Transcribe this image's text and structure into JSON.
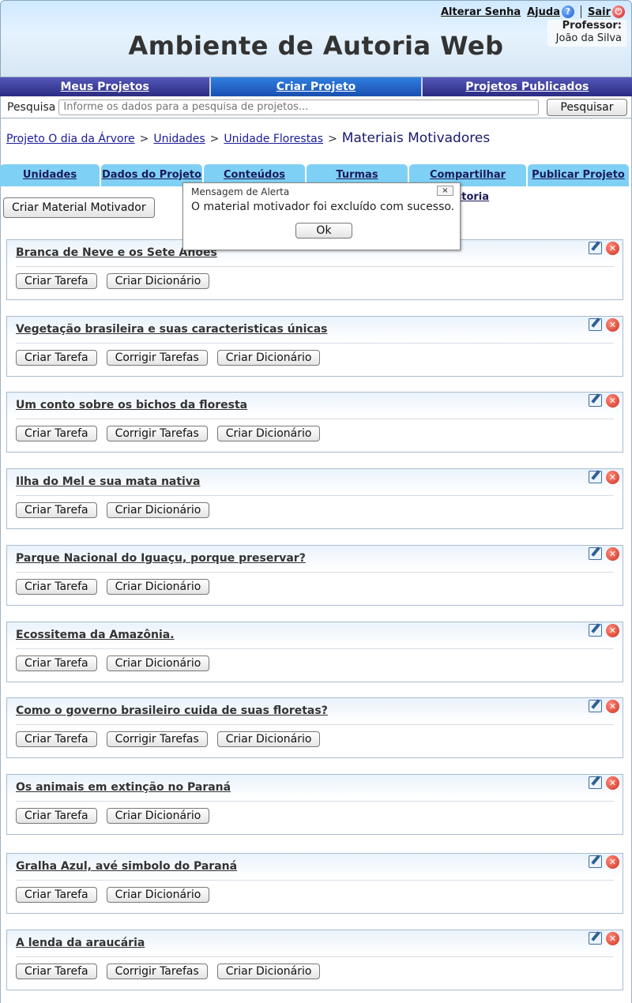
{
  "header": {
    "title": "Ambiente de Autoria Web",
    "links": {
      "change_password": "Alterar Senha",
      "help": "Ajuda",
      "logout": "Sair"
    },
    "professor_label": "Professor:",
    "professor_name": "João da Silva"
  },
  "main_nav": [
    "Meus Projetos",
    "Criar Projeto",
    "Projetos Publicados"
  ],
  "search": {
    "label": "Pesquisa",
    "placeholder": "Informe os dados para a pesquisa de projetos...",
    "button": "Pesquisar"
  },
  "breadcrumb": {
    "items": [
      "Projeto O dia da Árvore",
      "Unidades",
      "Unidade Florestas"
    ],
    "separator": ">",
    "current": "Materiais Motivadores"
  },
  "tabs": [
    "Unidades",
    "Dados do Projeto",
    "Conteúdos",
    "Turmas",
    "Compartilhar Autoria",
    "Publicar Projeto"
  ],
  "create_button": "Criar Material Motivador",
  "materials": [
    {
      "title": "Branca de Neve e os Sete Anões",
      "actions": [
        "Criar Tarefa",
        "Criar Dicionário"
      ]
    },
    {
      "title": "Vegetação brasileira e suas caracteristicas únicas",
      "actions": [
        "Criar Tarefa",
        "Corrigir Tarefas",
        "Criar Dicionário"
      ]
    },
    {
      "title": "Um conto sobre os bichos da floresta",
      "actions": [
        "Criar Tarefa",
        "Corrigir Tarefas",
        "Criar Dicionário"
      ]
    },
    {
      "title": "Ilha do Mel e sua mata nativa",
      "actions": [
        "Criar Tarefa",
        "Criar Dicionário"
      ]
    },
    {
      "title": "Parque Nacional do Iguaçu, porque preservar?",
      "actions": [
        "Criar Tarefa",
        "Criar Dicionário"
      ]
    },
    {
      "title": "Ecossitema da Amazônia.",
      "actions": [
        "Criar Tarefa",
        "Criar Dicionário"
      ]
    },
    {
      "title": "Como o governo brasileiro cuida de suas floretas?",
      "actions": [
        "Criar Tarefa",
        "Corrigir Tarefas",
        "Criar Dicionário"
      ]
    },
    {
      "title": "Os animais em extinção no Paraná",
      "actions": [
        "Criar Tarefa",
        "Criar Dicionário"
      ]
    },
    {
      "title": "Gralha Azul, avé simbolo do Paraná",
      "actions": [
        "Criar Tarefa",
        "Criar Dicionário"
      ]
    },
    {
      "title": "A lenda da araucária",
      "actions": [
        "Criar Tarefa",
        "Corrigir Tarefas",
        "Criar Dicionário"
      ]
    }
  ],
  "alert": {
    "title": "Mensagem de Alerta",
    "close": "×",
    "message": "O material motivador foi excluído com sucesso.",
    "ok": "Ok"
  },
  "colors": {
    "nav_bg": "#2e2f86",
    "nav_active": "#1f6fd6",
    "tab_bg": "#7fd0f5",
    "card_border": "#a9bccf"
  }
}
